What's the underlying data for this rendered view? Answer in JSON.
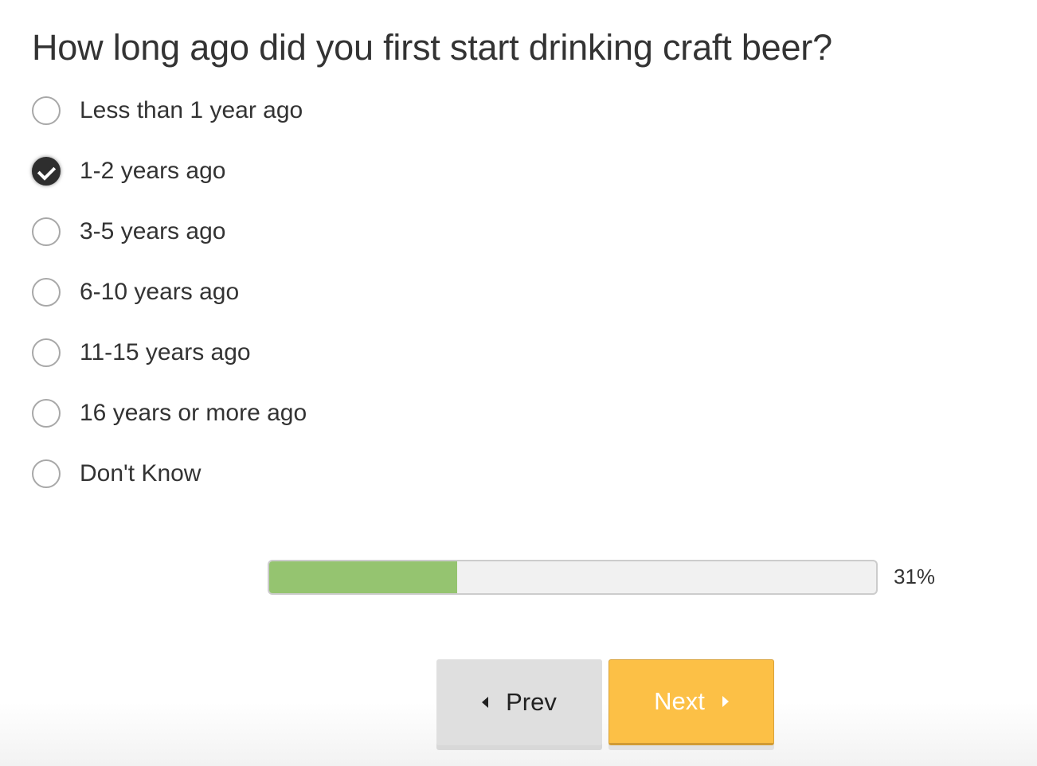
{
  "question": {
    "title": "How long ago did you first start drinking craft beer?"
  },
  "options": [
    {
      "label": "Less than 1 year ago",
      "checked": false
    },
    {
      "label": "1-2 years ago",
      "checked": true
    },
    {
      "label": "3-5 years ago",
      "checked": false
    },
    {
      "label": "6-10 years ago",
      "checked": false
    },
    {
      "label": "11-15 years ago",
      "checked": false
    },
    {
      "label": "16 years or more ago",
      "checked": false
    },
    {
      "label": "Don't Know",
      "checked": false
    }
  ],
  "progress": {
    "percent": 31,
    "label": "31%",
    "fill_color": "#95c470"
  },
  "navigation": {
    "prev_label": "Prev",
    "prev_icon": "caret-left-icon",
    "next_label": "Next",
    "next_icon": "caret-right-icon",
    "next_color": "#fcc046"
  }
}
